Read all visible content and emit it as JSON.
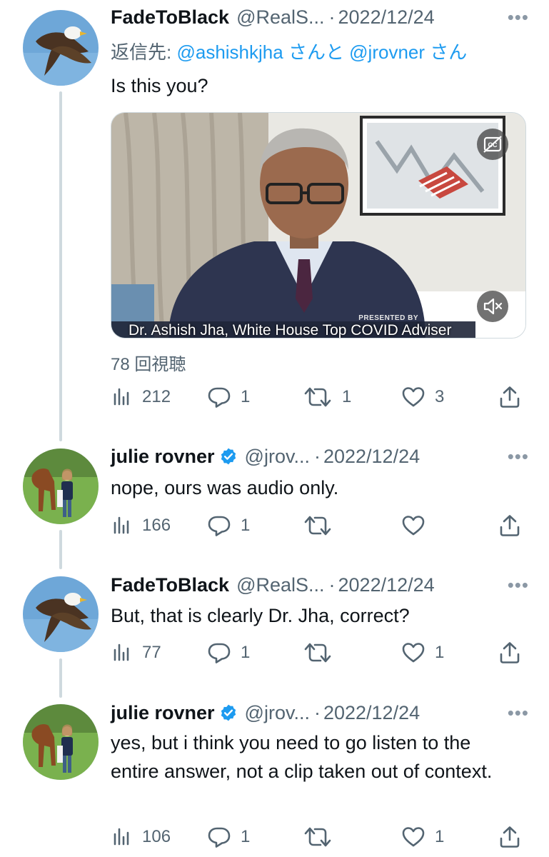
{
  "tweets": [
    {
      "avatar": "eagle-avatar",
      "name": "FadeToBlack",
      "handle": "@RealS...",
      "sep": "·",
      "date": "2022/12/24",
      "more": "•••",
      "reply_prefix": "返信先:",
      "reply_link": "@ashishkjha さんと @jrovner さん",
      "text": "Is this you?",
      "media": {
        "caption": "Dr. Ashish Jha, White House Top COVID Adviser",
        "presented_by": "PRESENTED BY",
        "cc_icon": "closed-captions-off-icon",
        "mute_icon": "speaker-muted-icon"
      },
      "views": "78 回視聴",
      "stats": {
        "views": "212",
        "replies": "1",
        "retweets": "1",
        "likes": "3"
      }
    },
    {
      "avatar": "horse-avatar",
      "name": "julie rovner",
      "verified": true,
      "handle": "@jrov...",
      "sep": "·",
      "date": "2022/12/24",
      "more": "•••",
      "text": "nope, ours was audio only.",
      "stats": {
        "views": "166",
        "replies": "1",
        "retweets": "",
        "likes": ""
      }
    },
    {
      "avatar": "eagle-avatar",
      "name": "FadeToBlack",
      "handle": "@RealS...",
      "sep": "·",
      "date": "2022/12/24",
      "more": "•••",
      "text": "But, that is clearly Dr. Jha, correct?",
      "stats": {
        "views": "77",
        "replies": "1",
        "retweets": "",
        "likes": "1"
      }
    },
    {
      "avatar": "horse-avatar",
      "name": "julie rovner",
      "verified": true,
      "handle": "@jrov...",
      "sep": "·",
      "date": "2022/12/24",
      "more": "•••",
      "text": "yes, but i think you need to go listen to the entire answer,  not a clip taken out of context.",
      "stats": {
        "views": "106",
        "replies": "1",
        "retweets": "",
        "likes": "1"
      }
    }
  ],
  "colors": {
    "link": "#1d9bf0",
    "verified": "#1d9bf0",
    "muted_text": "#536471",
    "thread_line": "#cfd9de"
  }
}
